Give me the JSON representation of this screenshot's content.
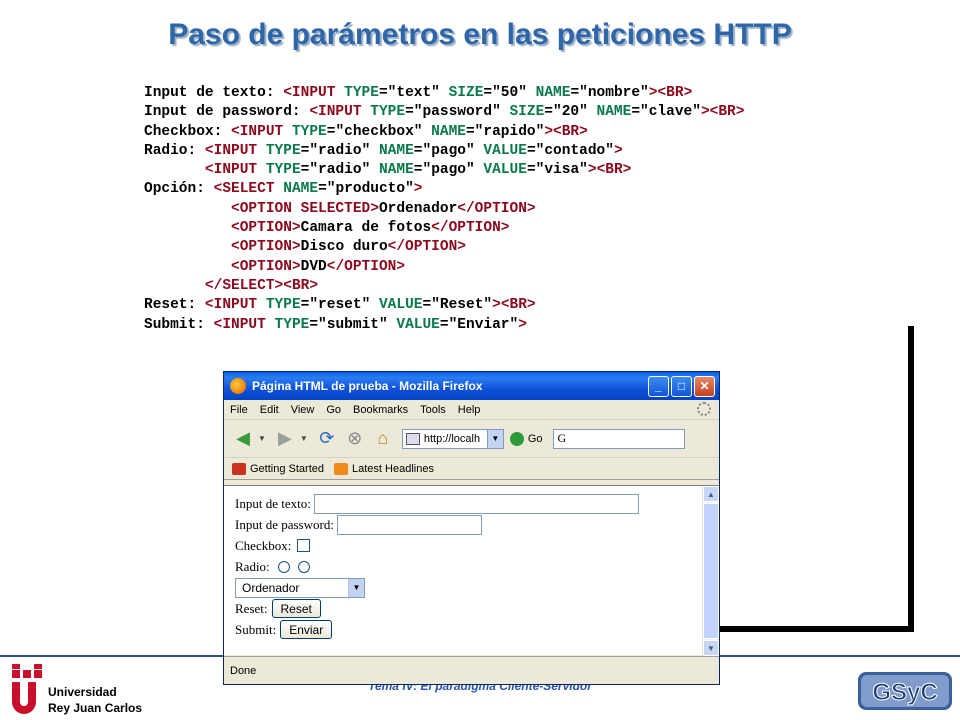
{
  "slide": {
    "title": "Paso de parámetros en las peticiones HTTP",
    "footer": "Tema IV: El paradigma Cliente-Servidor",
    "university": [
      "Universidad",
      "Rey Juan Carlos"
    ],
    "gsyc_logo": "GSyC"
  },
  "code_lines": [
    [
      [
        "Input de texto: ",
        "val"
      ],
      [
        "<INPUT ",
        "tag"
      ],
      [
        "TYPE",
        "attr"
      ],
      [
        "=\"text\" ",
        "val"
      ],
      [
        "SIZE",
        "attr"
      ],
      [
        "=\"50\" ",
        "val"
      ],
      [
        "NAME",
        "attr"
      ],
      [
        "=\"nombre\"",
        "val"
      ],
      [
        ">",
        "tag"
      ],
      [
        "<BR>",
        "tag"
      ]
    ],
    [
      [
        "Input de password: ",
        "val"
      ],
      [
        "<INPUT ",
        "tag"
      ],
      [
        "TYPE",
        "attr"
      ],
      [
        "=\"password\" ",
        "val"
      ],
      [
        "SIZE",
        "attr"
      ],
      [
        "=\"20\" ",
        "val"
      ],
      [
        "NAME",
        "attr"
      ],
      [
        "=\"clave\"",
        "val"
      ],
      [
        ">",
        "tag"
      ],
      [
        "<BR>",
        "tag"
      ]
    ],
    [
      [
        "Checkbox: ",
        "val"
      ],
      [
        "<INPUT ",
        "tag"
      ],
      [
        "TYPE",
        "attr"
      ],
      [
        "=\"checkbox\" ",
        "val"
      ],
      [
        "NAME",
        "attr"
      ],
      [
        "=\"rapido\"",
        "val"
      ],
      [
        ">",
        "tag"
      ],
      [
        "<BR>",
        "tag"
      ]
    ],
    [
      [
        "Radio: ",
        "val"
      ],
      [
        "<INPUT ",
        "tag"
      ],
      [
        "TYPE",
        "attr"
      ],
      [
        "=\"radio\" ",
        "val"
      ],
      [
        "NAME",
        "attr"
      ],
      [
        "=\"pago\" ",
        "val"
      ],
      [
        "VALUE",
        "attr"
      ],
      [
        "=\"contado\"",
        "val"
      ],
      [
        ">",
        "tag"
      ]
    ],
    [
      [
        "       ",
        "val"
      ],
      [
        "<INPUT ",
        "tag"
      ],
      [
        "TYPE",
        "attr"
      ],
      [
        "=\"radio\" ",
        "val"
      ],
      [
        "NAME",
        "attr"
      ],
      [
        "=\"pago\" ",
        "val"
      ],
      [
        "VALUE",
        "attr"
      ],
      [
        "=\"visa\"",
        "val"
      ],
      [
        ">",
        "tag"
      ],
      [
        "<BR>",
        "tag"
      ]
    ],
    [
      [
        "Opción: ",
        "val"
      ],
      [
        "<SELECT ",
        "tag"
      ],
      [
        "NAME",
        "attr"
      ],
      [
        "=\"producto\"",
        "val"
      ],
      [
        ">",
        "tag"
      ]
    ],
    [
      [
        "          ",
        "val"
      ],
      [
        "<OPTION SELECTED>",
        "tag"
      ],
      [
        "Ordenador",
        "val"
      ],
      [
        "</OPTION>",
        "tag"
      ]
    ],
    [
      [
        "          ",
        "val"
      ],
      [
        "<OPTION>",
        "tag"
      ],
      [
        "Camara de fotos",
        "val"
      ],
      [
        "</OPTION>",
        "tag"
      ]
    ],
    [
      [
        "          ",
        "val"
      ],
      [
        "<OPTION>",
        "tag"
      ],
      [
        "Disco duro",
        "val"
      ],
      [
        "</OPTION>",
        "tag"
      ]
    ],
    [
      [
        "          ",
        "val"
      ],
      [
        "<OPTION>",
        "tag"
      ],
      [
        "DVD",
        "val"
      ],
      [
        "</OPTION>",
        "tag"
      ]
    ],
    [
      [
        "       ",
        "val"
      ],
      [
        "</SELECT>",
        "tag"
      ],
      [
        "<BR>",
        "tag"
      ]
    ],
    [
      [
        "Reset: ",
        "val"
      ],
      [
        "<INPUT ",
        "tag"
      ],
      [
        "TYPE",
        "attr"
      ],
      [
        "=\"reset\" ",
        "val"
      ],
      [
        "VALUE",
        "attr"
      ],
      [
        "=\"Reset\"",
        "val"
      ],
      [
        ">",
        "tag"
      ],
      [
        "<BR>",
        "tag"
      ]
    ],
    [
      [
        "Submit: ",
        "val"
      ],
      [
        "<INPUT ",
        "tag"
      ],
      [
        "TYPE",
        "attr"
      ],
      [
        "=\"submit\" ",
        "val"
      ],
      [
        "VALUE",
        "attr"
      ],
      [
        "=\"Enviar\"",
        "val"
      ],
      [
        ">",
        "tag"
      ]
    ]
  ],
  "browser": {
    "title": "Página HTML de prueba - Mozilla Firefox",
    "menu": [
      "File",
      "Edit",
      "View",
      "Go",
      "Bookmarks",
      "Tools",
      "Help"
    ],
    "url": "http://localh",
    "go_label": "Go",
    "search_value": "G",
    "bookmarks": [
      "Getting Started",
      "Latest Headlines"
    ],
    "status": "Done",
    "form": {
      "text_label": "Input de texto:",
      "password_label": "Input de password:",
      "checkbox_label": "Checkbox:",
      "radio_label": "Radio:",
      "select_value": "Ordenador",
      "reset_label": "Reset:",
      "reset_button": "Reset",
      "submit_label": "Submit:",
      "submit_button": "Enviar"
    }
  }
}
